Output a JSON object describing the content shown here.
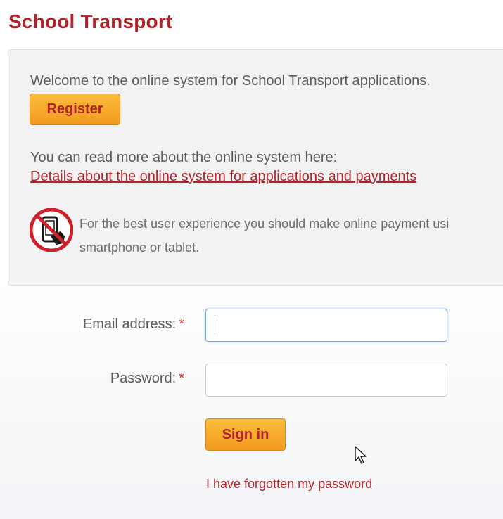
{
  "page": {
    "title": "School Transport"
  },
  "info": {
    "welcome": "Welcome to the online system for School Transport applications.",
    "register_label": "Register",
    "read_more": "You can read more about the online system here:",
    "details_link": "Details about the online system for applications and payments",
    "notice_line1": "For the best user experience you should make online payment usi",
    "notice_line2": "smartphone or tablet."
  },
  "login": {
    "email_label": "Email address:",
    "password_label": "Password:",
    "required_marker": "*",
    "email_value": "",
    "password_value": "",
    "signin_label": "Sign in",
    "forgot_link": "I have forgotten my password"
  },
  "icons": {
    "no_phone": "no-phone-icon",
    "cursor": "mouse-pointer-icon"
  },
  "colors": {
    "brand_red": "#b4232a",
    "button_orange": "#f5a623",
    "panel_bg": "#f2f2f2",
    "focus_blue": "#7aa8e0"
  }
}
